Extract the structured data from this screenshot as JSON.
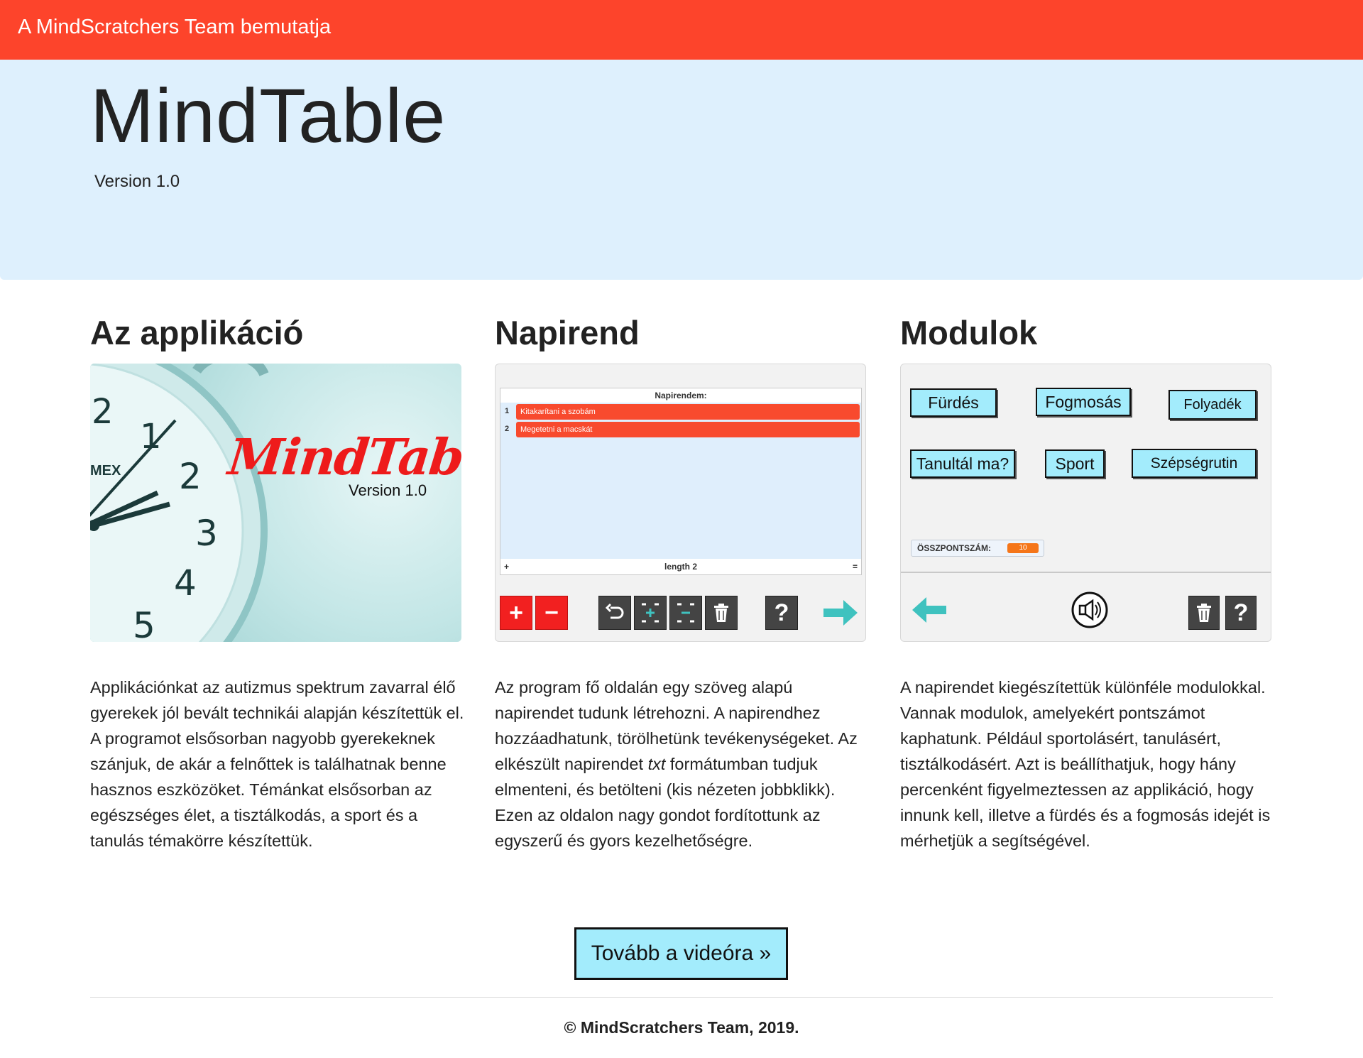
{
  "topbar": {
    "text": "A MindScratchers Team bemutatja"
  },
  "hero": {
    "title": "MindTable",
    "version": "Version 1.0"
  },
  "columns": [
    {
      "heading": "Az applikáció",
      "image": {
        "brand": "MindTable",
        "version": "Version 1.0",
        "dial_numbers": [
          "1",
          "2",
          "3",
          "4",
          "5",
          "2"
        ],
        "dial_text": "MEX",
        "icon": "alarm-clock-icon"
      },
      "text": "Applikációnkat az autizmus spektrum zavarral élő gyerekek jól bevált technikái alapján készítettük el. A programot elsősorban nagyobb gyerekeknek szánjuk, de akár a felnőttek is találhatnak benne hasznos eszközöket. Témánkat elsősorban az egészséges élet, a tisztálkodás, a sport és a tanulás témakörre készítettük."
    },
    {
      "heading": "Napirend",
      "image": {
        "list_title": "Napirendem:",
        "items": [
          {
            "num": "1",
            "label": "Kitakarítani a szobám"
          },
          {
            "num": "2",
            "label": "Megetetni a macskát"
          }
        ],
        "footer": "length 2",
        "footer_left": "+",
        "footer_right": "="
      },
      "text_parts": {
        "before": "Az program fő oldalán egy szöveg alapú napirendet tudunk létrehozni. A napirendhez hozzáadhatunk, törölhetünk tevékenységeket. Az elkészült napirendet ",
        "italic": "txt",
        "after": " formátumban tudjuk elmenteni, és betölteni (kis nézeten jobbklikk). Ezen az oldalon nagy gondot fordítottunk az egyszerű és gyors kezelhetőségre."
      }
    },
    {
      "heading": "Modulok",
      "image": {
        "modules": [
          "Fürdés",
          "Fogmosás",
          "Folyadék",
          "Tanultál ma?",
          "Sport",
          "Szépségrutin"
        ],
        "score_label": "ÖSSZPONTSZÁM:",
        "score_value": "10",
        "help": "?"
      },
      "text": "A napirendet kiegészítettük különféle modulokkal. Vannak modulok, amelyekért pontszámot kaphatunk. Például sportolásért, tanulásért, tisztálkodásért. Azt is beállíthatjuk, hogy hány percenként figyelmeztessen az applikáció, hogy innunk kell, illetve a fürdés és a fogmosás idejét is mérhetjük a segítségével."
    }
  ],
  "toolbar": {
    "add": "+",
    "remove": "−",
    "help": "?"
  },
  "cta": {
    "label": "Tovább a videóra »"
  },
  "footer": {
    "text": "© MindScratchers Team, 2019."
  },
  "colors": {
    "topbar": "#fd442b",
    "hero": "#def0fd",
    "cta": "#a3ecfc",
    "list_item": "#f84a2e",
    "teal_arrow": "#3fc2bf"
  }
}
